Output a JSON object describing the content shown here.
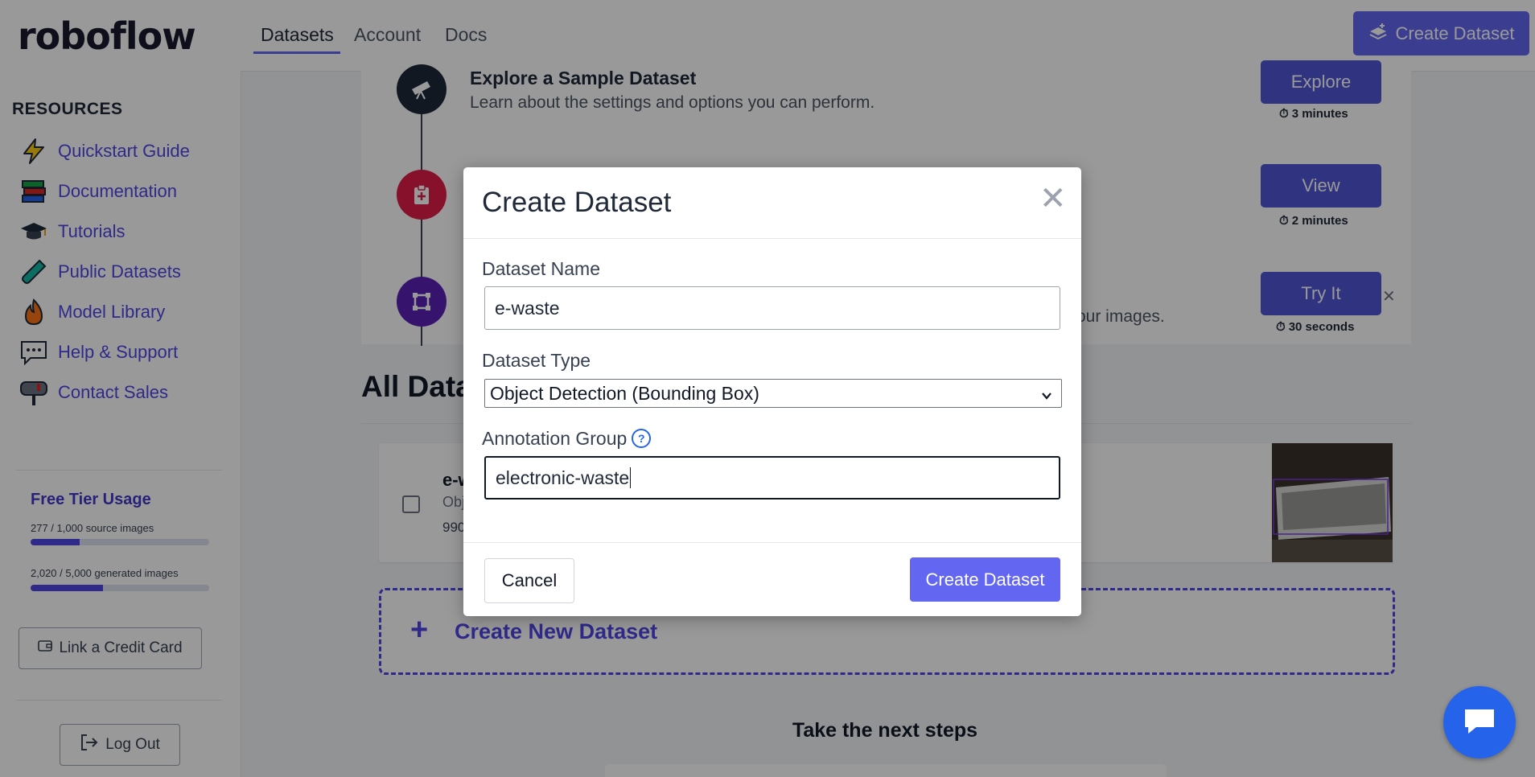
{
  "header": {
    "logo": "roboflow",
    "nav": [
      "Datasets",
      "Account",
      "Docs"
    ],
    "create_button": "Create Dataset",
    "accent": "#6366f1"
  },
  "sidebar": {
    "resources_title": "RESOURCES",
    "links": [
      {
        "label": "Quickstart Guide",
        "icon": "lightning-icon"
      },
      {
        "label": "Documentation",
        "icon": "books-icon"
      },
      {
        "label": "Tutorials",
        "icon": "graduation-cap-icon"
      },
      {
        "label": "Public Datasets",
        "icon": "test-tube-icon"
      },
      {
        "label": "Model Library",
        "icon": "flame-icon"
      },
      {
        "label": "Help & Support",
        "icon": "speech-bubble-icon"
      },
      {
        "label": "Contact Sales",
        "icon": "mailbox-icon"
      }
    ],
    "usage": {
      "title": "Free Tier Usage",
      "source_label": "277 / 1,000 source images",
      "source_fraction": 0.277,
      "generated_label": "2,020 / 5,000 generated images",
      "generated_fraction": 0.404
    },
    "credit_card_button": "Link a Credit Card",
    "logout_button": "Log Out"
  },
  "steps": [
    {
      "title": "Explore a Sample Dataset",
      "description": "Learn about the settings and options you can perform.",
      "button": "Explore",
      "time": "3 minutes",
      "icon": "telescope-icon",
      "color": "#1f2937"
    },
    {
      "title": "",
      "description": "",
      "button": "View",
      "time": "2 minutes",
      "icon": "clipboard-icon",
      "color": "#e11d48"
    },
    {
      "title": "",
      "description": "our images.",
      "button": "Try It",
      "time": "30 seconds",
      "icon": "bounding-box-icon",
      "color": "#5b21b6"
    }
  ],
  "all_datasets": {
    "title": "All Data",
    "row": {
      "name": "e-w",
      "type": "Obj",
      "count": "990"
    },
    "create_new": "Create New Dataset"
  },
  "next_steps_title": "Take the next steps",
  "modal": {
    "title": "Create Dataset",
    "name_label": "Dataset Name",
    "name_value": "e-waste",
    "type_label": "Dataset Type",
    "type_value": "Object Detection (Bounding Box)",
    "group_label": "Annotation Group",
    "group_value": "electronic-waste",
    "cancel": "Cancel",
    "submit": "Create Dataset"
  }
}
